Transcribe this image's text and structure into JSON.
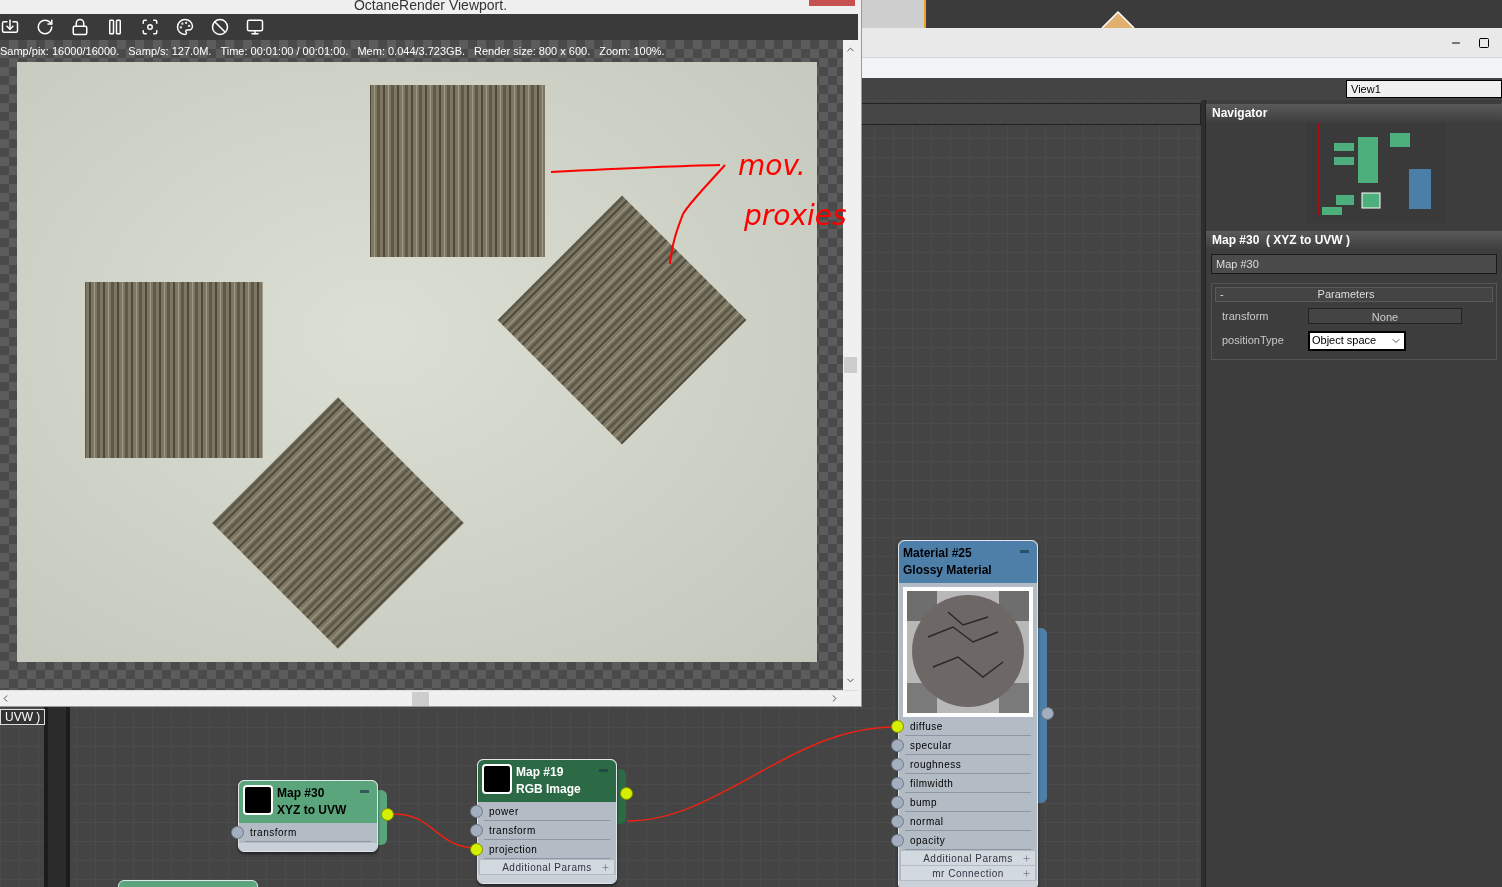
{
  "viewport_window": {
    "title": "OctaneRender Viewport.",
    "status": [
      "Samp/pix: 16000/16000.",
      "Samp/s: 127.0M.",
      "Time: 00:01:00 / 00:01:00.",
      "Mem: 0.044/3.723GB.",
      "Render size: 800 x 600.",
      "Zoom: 100%."
    ],
    "annotation": [
      "mov.",
      "proxies"
    ]
  },
  "editor": {
    "view_field": {
      "value": "View1"
    },
    "navigator": {
      "title": "Navigator"
    },
    "properties": {
      "title": "Map #30  ( XYZ to UVW )",
      "name_field": {
        "value": "Map #30"
      },
      "rollout": {
        "toggle": "-",
        "title": "Parameters",
        "expanded": true
      },
      "params": [
        {
          "kind": "button",
          "label": "transform",
          "value": "None"
        },
        {
          "kind": "dropdown",
          "label": "positionType",
          "value": "Object space"
        }
      ]
    }
  },
  "canvas": {
    "partial_label": "UVW )",
    "nodes": [
      {
        "kind": "map",
        "title": "Map #30",
        "subtitle": "XYZ to UVW",
        "color": "#5aa57c",
        "sockets": [
          {
            "label": "transform",
            "connected": false
          }
        ],
        "output_connected": true
      },
      {
        "kind": "map",
        "title": "Map #19",
        "subtitle": "RGB Image",
        "color": "#2b6a44",
        "sockets": [
          {
            "label": "power",
            "connected": false
          },
          {
            "label": "transform",
            "connected": false
          },
          {
            "label": "projection",
            "connected": true
          }
        ],
        "footers": [
          "Additional Params"
        ],
        "output_connected": true
      },
      {
        "kind": "material",
        "title": "Material #25",
        "subtitle": "Glossy Material",
        "color": "#4d7fa9",
        "sockets": [
          {
            "label": "diffuse",
            "connected": true
          },
          {
            "label": "specular",
            "connected": false
          },
          {
            "label": "roughness",
            "connected": false
          },
          {
            "label": "filmwidth",
            "connected": false
          },
          {
            "label": "bump",
            "connected": false
          },
          {
            "label": "normal",
            "connected": false
          },
          {
            "label": "opacity",
            "connected": false
          }
        ],
        "footers": [
          "Additional Params",
          "mr Connection"
        ],
        "output_connected": false
      }
    ]
  }
}
